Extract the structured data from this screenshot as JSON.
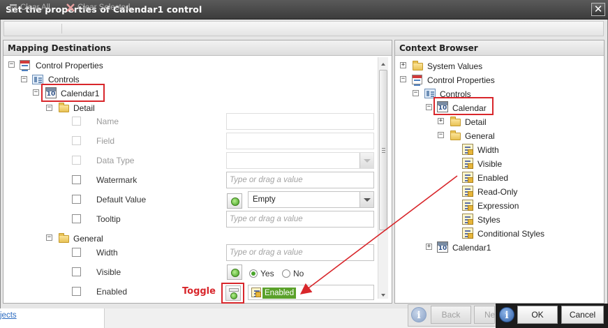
{
  "window": {
    "title": "Set the properties of Calendar1 control",
    "close_glyph": "✕"
  },
  "toolbar": {
    "clear_all": "Clear All",
    "clear_selected": "Clear Selected"
  },
  "left_panel": {
    "header": "Mapping Destinations",
    "tree": {
      "control_properties": "Control Properties",
      "controls": "Controls",
      "calendar1": "Calendar1",
      "detail": "Detail",
      "general": "General"
    },
    "detail_rows": [
      {
        "label": "Name",
        "value": "",
        "placeholder": ""
      },
      {
        "label": "Field",
        "value": "",
        "placeholder": ""
      },
      {
        "label": "Data Type",
        "value": "",
        "placeholder": ""
      },
      {
        "label": "Watermark",
        "value": "",
        "placeholder": "Type or drag a value"
      },
      {
        "label": "Default Value",
        "value": "Empty",
        "placeholder": ""
      },
      {
        "label": "Tooltip",
        "value": "",
        "placeholder": "Type or drag a value"
      }
    ],
    "general_rows": [
      {
        "label": "Width",
        "placeholder": "Type or drag a value"
      },
      {
        "label": "Visible",
        "radio_yes": "Yes",
        "radio_no": "No",
        "selected": "Yes"
      },
      {
        "label": "Enabled",
        "token": "Enabled"
      }
    ]
  },
  "right_panel": {
    "header": "Context Browser",
    "tree": {
      "system_values": "System Values",
      "control_properties": "Control Properties",
      "controls": "Controls",
      "calendar": "Calendar",
      "detail": "Detail",
      "general": "General",
      "properties": [
        "Width",
        "Visible",
        "Enabled",
        "Read-Only",
        "Expression",
        "Styles",
        "Conditional Styles"
      ],
      "calendar1": "Calendar1"
    }
  },
  "annotation": {
    "toggle_label": "Toggle",
    "color": "#d8262b"
  },
  "footer": {
    "back": "Back",
    "next_partial": "Ne",
    "ok": "OK",
    "cancel": "Cancel",
    "bottom_link": "jects"
  },
  "icons": {
    "calendar": "10",
    "info": "i"
  }
}
